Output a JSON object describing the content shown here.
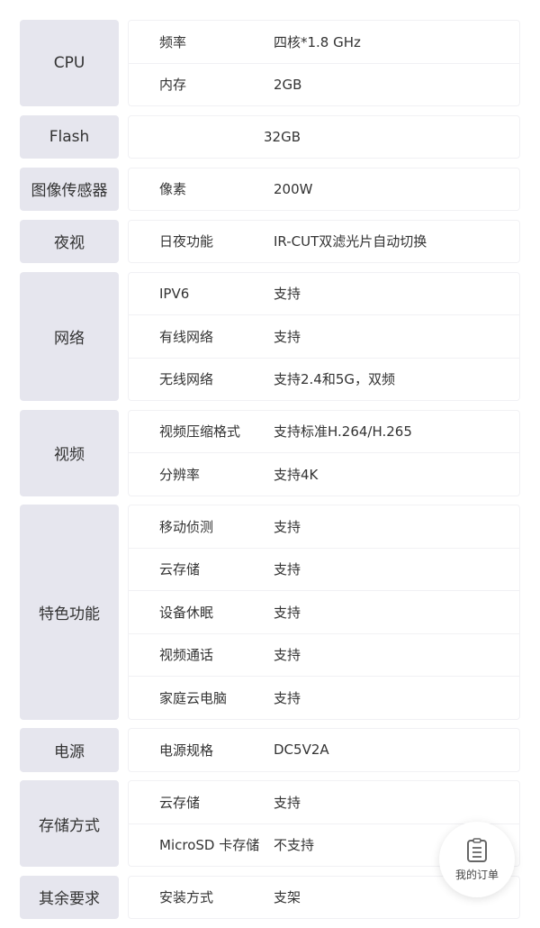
{
  "groups": [
    {
      "label": "CPU",
      "rows": [
        {
          "key": "频率",
          "value": "四核*1.8 GHz"
        },
        {
          "key": "内存",
          "value": "2GB"
        }
      ]
    },
    {
      "label": "Flash",
      "rows": [
        {
          "key": "",
          "value": "32GB",
          "single": true
        }
      ]
    },
    {
      "label": "图像传感器",
      "rows": [
        {
          "key": "像素",
          "value": "200W"
        }
      ]
    },
    {
      "label": "夜视",
      "rows": [
        {
          "key": "日夜功能",
          "value": "IR-CUT双滤光片自动切换"
        }
      ]
    },
    {
      "label": "网络",
      "rows": [
        {
          "key": "IPV6",
          "value": "支持"
        },
        {
          "key": "有线网络",
          "value": "支持"
        },
        {
          "key": "无线网络",
          "value": "支持2.4和5G，双频"
        }
      ]
    },
    {
      "label": "视频",
      "rows": [
        {
          "key": "视频压缩格式",
          "value": "支持标准H.264/H.265"
        },
        {
          "key": "分辨率",
          "value": "支持4K"
        }
      ]
    },
    {
      "label": "特色功能",
      "rows": [
        {
          "key": "移动侦测",
          "value": "支持"
        },
        {
          "key": "云存储",
          "value": "支持"
        },
        {
          "key": "设备休眠",
          "value": "支持"
        },
        {
          "key": "视频通话",
          "value": "支持"
        },
        {
          "key": "家庭云电脑",
          "value": "支持"
        }
      ]
    },
    {
      "label": "电源",
      "rows": [
        {
          "key": "电源规格",
          "value": "DC5V2A"
        }
      ]
    },
    {
      "label": "存储方式",
      "rows": [
        {
          "key": "云存储",
          "value": "支持"
        },
        {
          "key": "MicroSD 卡存储",
          "value": "不支持"
        }
      ]
    },
    {
      "label": "其余要求",
      "rows": [
        {
          "key": "安装方式",
          "value": "支架"
        }
      ]
    }
  ],
  "fab": {
    "label": "我的订单",
    "icon": "clipboard-icon"
  }
}
